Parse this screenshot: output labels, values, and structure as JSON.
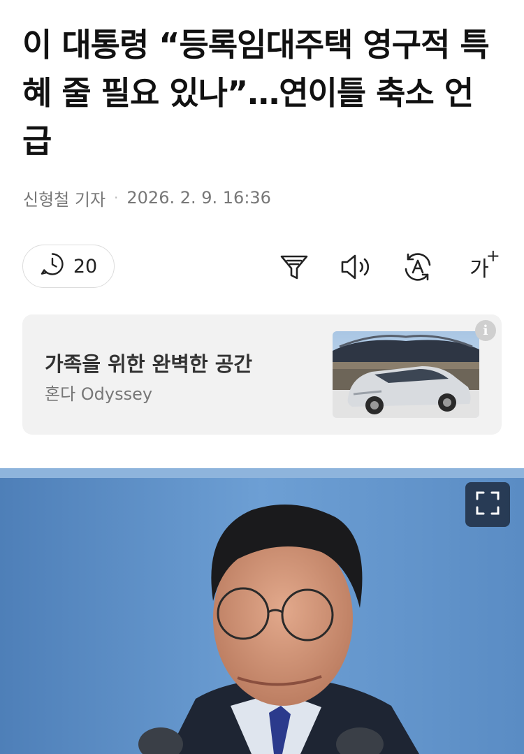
{
  "article": {
    "headline": "이 대통령 “등록임대주택 영구적 특혜 줄 필요 있나”…연이틀 축소 언급",
    "reporter": "신형철 기자",
    "separator": "·",
    "datetime": "2026. 2. 9. 16:36"
  },
  "toolbar": {
    "comment_count": "20",
    "font_size_label": "가",
    "font_size_plus": "+",
    "icons": [
      "clock-comment-icon",
      "filter-icon",
      "speaker-icon",
      "translate-icon",
      "font-size-icon"
    ]
  },
  "ad": {
    "headline": "가족을 위한 완벽한 공간",
    "subtitle": "혼다 Odyssey",
    "info_label": "i"
  },
  "photo": {
    "fullscreen_icon": "expand-icon"
  }
}
